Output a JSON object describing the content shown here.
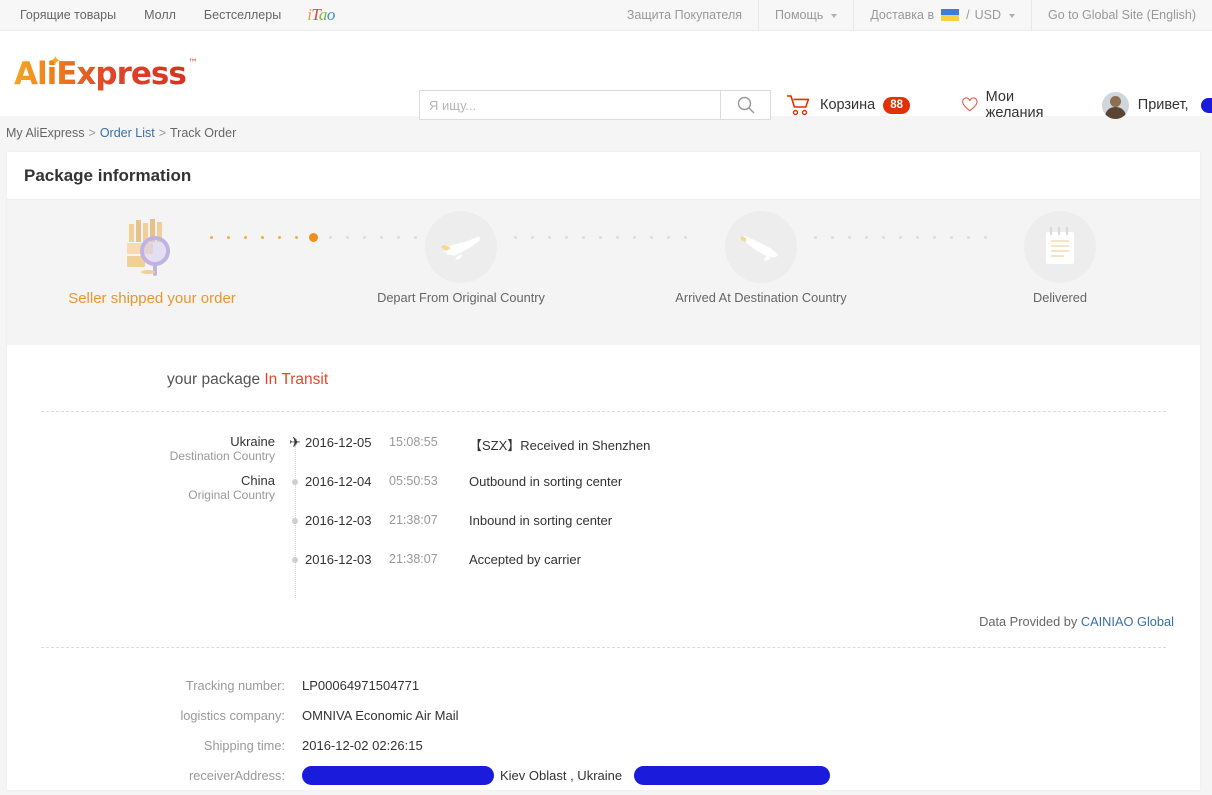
{
  "topbar": {
    "left_links": [
      "Горящие товары",
      "Молл",
      "Бестселлеры"
    ],
    "itao": {
      "c1": "i",
      "c2": "T",
      "c3": "a",
      "c4": "o"
    },
    "buyer_protection": "Защита Покупателя",
    "help": "Помощь",
    "ship_to": "Доставка в",
    "currency_sep": "/",
    "currency": "USD",
    "global_site": "Go to Global Site (English)"
  },
  "header": {
    "logo_ali": "Ali",
    "logo_express": "Express",
    "logo_tm": "™",
    "search": {
      "value": "",
      "placeholder": "Я ищу..."
    },
    "cart_label": "Корзина",
    "cart_count": "88",
    "wishlist_label": "Мои желания",
    "greeting": "Привет,",
    "username_redacted": ""
  },
  "breadcrumb": {
    "item1": "My AliExpress",
    "sep1": ">",
    "item2": "Order List",
    "sep2": ">",
    "item3": "Track Order"
  },
  "panel": {
    "title": "Package information"
  },
  "tracker": {
    "steps": [
      {
        "label": "Seller shipped your order",
        "icon": "package-magnifier-icon",
        "state": "active"
      },
      {
        "label": "Depart From Original Country",
        "icon": "airplane-depart-icon",
        "state": "pending"
      },
      {
        "label": "Arrived At Destination Country",
        "icon": "airplane-arrive-icon",
        "state": "pending"
      },
      {
        "label": "Delivered",
        "icon": "notepad-icon",
        "state": "pending"
      }
    ]
  },
  "status": {
    "prefix": "your package",
    "value": "In Transit"
  },
  "timeline": {
    "rows": [
      {
        "country": "Ukraine",
        "country_sub": "Destination Country",
        "marker": "plane",
        "date": "2016-12-05",
        "time": "15:08:55",
        "desc": "【SZX】Received in Shenzhen"
      },
      {
        "country": "China",
        "country_sub": "Original Country",
        "marker": "dot",
        "date": "2016-12-04",
        "time": "05:50:53",
        "desc": "Outbound in sorting center"
      },
      {
        "country": "",
        "country_sub": "",
        "marker": "dot",
        "date": "2016-12-03",
        "time": "21:38:07",
        "desc": "Inbound in sorting center"
      },
      {
        "country": "",
        "country_sub": "",
        "marker": "dot",
        "date": "2016-12-03",
        "time": "21:38:07",
        "desc": "Accepted by carrier"
      }
    ]
  },
  "provider": {
    "text": "Data Provided by",
    "link": "CAINIAO Global"
  },
  "info": {
    "tracking_label": "Tracking number:",
    "tracking_value": "LP00064971504771",
    "company_label": "logistics company:",
    "company_value": "OMNIVA Economic Air Mail",
    "shipping_label": "Shipping time:",
    "shipping_value": "2016-12-02 02:26:15",
    "address_label": "receiverAddress:",
    "address_visible": "Kiev Oblast , Ukraine"
  },
  "colors": {
    "brand_orange": "#ef8f1c",
    "brand_red": "#e62e04",
    "link_blue": "#3a6ea5",
    "status_red": "#e8452b",
    "redaction_blue": "#1b1bdc"
  }
}
